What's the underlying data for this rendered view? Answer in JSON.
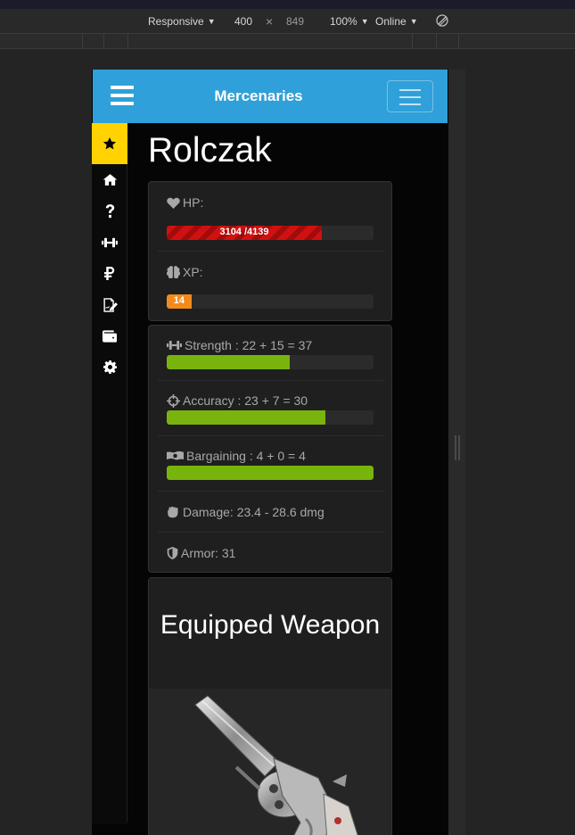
{
  "devtools": {
    "device": "Responsive",
    "width": "400",
    "times": "×",
    "height": "849",
    "zoom": "100%",
    "throttle": "Online"
  },
  "navbar": {
    "brand": "Mercenaries"
  },
  "sidebar": {
    "items": [
      {
        "icon": "star-icon",
        "active": true
      },
      {
        "icon": "home-icon"
      },
      {
        "icon": "question-icon"
      },
      {
        "icon": "dumbbell-icon"
      },
      {
        "icon": "ruble-icon"
      },
      {
        "icon": "signature-icon"
      },
      {
        "icon": "wallet-icon"
      },
      {
        "icon": "gear-icon"
      }
    ]
  },
  "character": {
    "name": "Rolczak",
    "hp": {
      "label": "HP:",
      "value_text": "3104 /4139",
      "current": 3104,
      "max": 4139,
      "color": "#d01111"
    },
    "xp": {
      "label": "XP:",
      "value_text": "14",
      "fraction": 0.12,
      "color": "#f28b1b"
    }
  },
  "stats": [
    {
      "label": "Strength : 22 + 15 = 37",
      "fraction": 0.595,
      "icon": "dumbbell-icon"
    },
    {
      "label": "Accuracy : 23 + 7 = 30",
      "fraction": 0.767,
      "icon": "crosshairs-icon"
    },
    {
      "label": "Bargaining : 4 + 0 = 4",
      "fraction": 1.0,
      "icon": "money-icon"
    }
  ],
  "damage": {
    "label": "Damage: 23.4 - 28.6 dmg"
  },
  "armor": {
    "label": "Armor: 31"
  },
  "weapon": {
    "title": "Equipped Weapon",
    "image": "revolver"
  },
  "colors": {
    "navbar": "#2fa0d9",
    "active_sidebar": "#ffd200",
    "stat_bar": "#78b40c"
  }
}
